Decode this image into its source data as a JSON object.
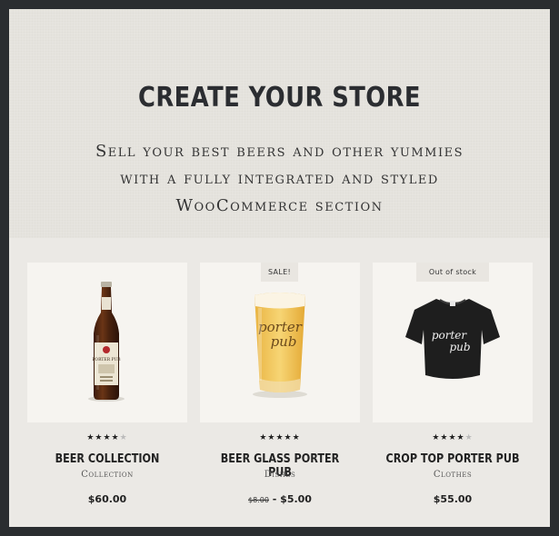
{
  "hero": {
    "title": "CREATE YOUR STORE",
    "line1": "Sell your best beers and other yummies",
    "line2": "with a fully integrated and styled",
    "line3": "WooCommerce section"
  },
  "products": [
    {
      "name": "BEER COLLECTION",
      "category": "Collection",
      "price": "$60.00",
      "rating": 4,
      "badge": "",
      "bottle_label": "PORTER PUB"
    },
    {
      "name": "BEER GLASS PORTER PUB",
      "category": "Dishes",
      "old_price": "$8.00",
      "price_sep": " - ",
      "price": "$5.00",
      "rating": 5,
      "badge": "SALE!",
      "glass_text_1": "porter",
      "glass_text_2": "pub"
    },
    {
      "name": "CROP TOP PORTER PUB",
      "category": "Clothes",
      "price": "$55.00",
      "rating": 4,
      "badge": "Out of stock",
      "shirt_text_1": "porter",
      "shirt_text_2": "pub"
    }
  ],
  "colors": {
    "frame": "#2a2d30",
    "background": "#ebe9e5",
    "card": "#f6f4f0",
    "text": "#222222"
  }
}
